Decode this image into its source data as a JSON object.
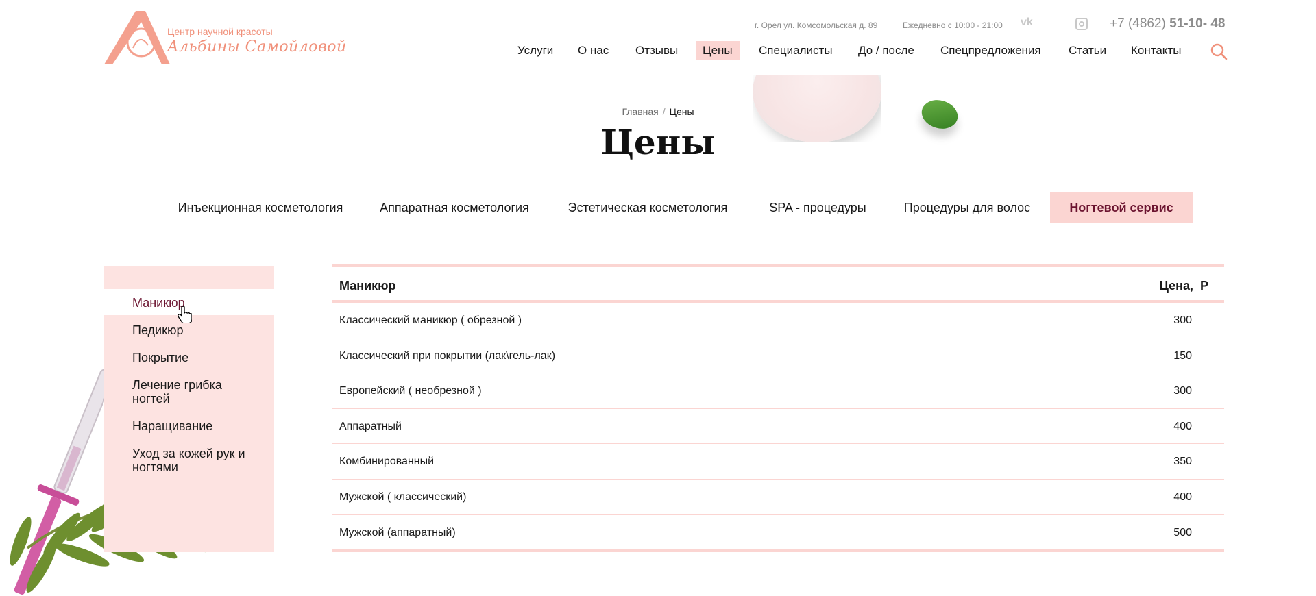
{
  "header": {
    "logo_line1": "Центр научной красоты",
    "logo_line2": "Альбины Самойловой",
    "address": "г. Орел ул. Комсомольская д. 89",
    "hours": "Ежедневно с 10:00 - 21:00",
    "social": [
      "vk-icon",
      "instagram-icon"
    ],
    "phone_prefix": "+7 (4862) ",
    "phone_main": "51-10- 48"
  },
  "nav": {
    "items": [
      "Услуги",
      "О нас",
      "Отзывы",
      "Цены",
      "Специалисты",
      "До / после",
      "Спецпредложения",
      "Статьи",
      "Контакты"
    ],
    "active": "Цены",
    "search_icon": "search-icon"
  },
  "breadcrumb": {
    "home": "Главная",
    "separator": "/",
    "current": "Цены"
  },
  "page": {
    "title": "Цены"
  },
  "categories": {
    "items": [
      "Инъекционная косметология",
      "Аппаратная косметология",
      "Эстетическая косметология",
      "SPA - процедуры",
      "Процедуры для волос",
      "Ногтевой сервис"
    ],
    "active": "Ногтевой сервис"
  },
  "sidebar": {
    "items": [
      "Маникюр",
      "Педикюр",
      "Покрытие",
      "Лечение грибка ногтей",
      "Наращивание",
      "Уход за кожей рук и ногтями"
    ],
    "active": "Маникюр"
  },
  "price_table": {
    "header_name": "Маникюр",
    "header_price": "Цена,",
    "currency_symbol": "Р",
    "rows": [
      {
        "name": "Классический маникюр ( обрезной )",
        "price": "300"
      },
      {
        "name": "Классический при покрытии (лак\\гель-лак)",
        "price": "150"
      },
      {
        "name": "Европейский ( необрезной )",
        "price": "300"
      },
      {
        "name": "Аппаратный",
        "price": "400"
      },
      {
        "name": "Комбинированный",
        "price": "350"
      },
      {
        "name": "Мужской ( классический)",
        "price": "400"
      },
      {
        "name": "Мужской (аппаратный)",
        "price": "500"
      }
    ]
  },
  "colors": {
    "accent": "#fbd5d2",
    "accent_dark": "#6b1430",
    "logo": "#f0907a"
  }
}
